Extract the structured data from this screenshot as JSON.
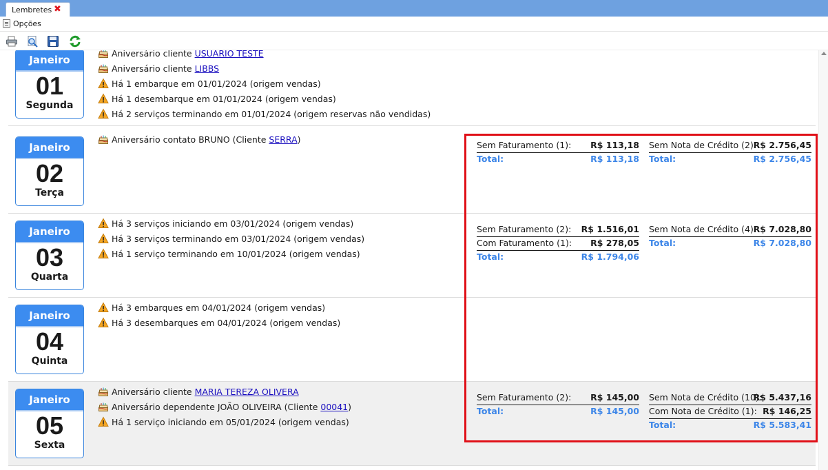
{
  "tab": {
    "title": "Lembretes"
  },
  "menu": {
    "options_label": "Opções"
  },
  "toolbar": {
    "buttons": [
      "print-icon",
      "preview-icon",
      "save-icon",
      "refresh-icon"
    ]
  },
  "colors": {
    "calendar_header": "#3c8cf0",
    "total_text": "#3d86e8",
    "highlight_border": "#e01018"
  },
  "days": [
    {
      "month": "Janeiro",
      "day": "01",
      "weekday": "Segunda",
      "events": [
        {
          "icon": "cake-icon",
          "text": "Aniversário cliente ",
          "link": "USUARIO TESTE",
          "suffix": ""
        },
        {
          "icon": "cake-icon",
          "text": "Aniversário cliente ",
          "link": "LIBBS",
          "suffix": ""
        },
        {
          "icon": "warning-icon",
          "text": "Há 1 embarque em 01/01/2024 (origem vendas)"
        },
        {
          "icon": "warning-icon",
          "text": "Há 1 desembarque em 01/01/2024 (origem vendas)"
        },
        {
          "icon": "warning-icon",
          "text": "Há 2 serviços terminando em 01/01/2024 (origem reservas não vendidas)"
        }
      ],
      "financial": null
    },
    {
      "month": "Janeiro",
      "day": "02",
      "weekday": "Terça",
      "events": [
        {
          "icon": "cake-icon",
          "text": "Aniversário contato BRUNO (Cliente ",
          "link": "SERRA",
          "suffix": ")"
        }
      ],
      "financial": {
        "col1": [
          {
            "label": "Sem Faturamento (1):",
            "value": "R$ 113,18"
          },
          {
            "label": "Total:",
            "value": "R$ 113,18",
            "total": true
          }
        ],
        "col2": [
          {
            "label": "Sem Nota de Crédito (2):",
            "value": "R$ 2.756,45"
          },
          {
            "label": "Total:",
            "value": "R$ 2.756,45",
            "total": true
          }
        ]
      }
    },
    {
      "month": "Janeiro",
      "day": "03",
      "weekday": "Quarta",
      "events": [
        {
          "icon": "warning-icon",
          "text": "Há 3 serviços iniciando em 03/01/2024 (origem vendas)"
        },
        {
          "icon": "warning-icon",
          "text": "Há 3 serviços terminando em 03/01/2024 (origem vendas)"
        },
        {
          "icon": "warning-icon",
          "text": "Há 1 serviço terminando em 10/01/2024 (origem vendas)"
        }
      ],
      "financial": {
        "col1": [
          {
            "label": "Sem Faturamento (2):",
            "value": "R$ 1.516,01"
          },
          {
            "label": "Com Faturamento (1):",
            "value": "R$ 278,05"
          },
          {
            "label": "Total:",
            "value": "R$ 1.794,06",
            "total": true
          }
        ],
        "col2": [
          {
            "label": "Sem Nota de Crédito (4):",
            "value": "R$ 7.028,80"
          },
          {
            "label": "Total:",
            "value": "R$ 7.028,80",
            "total": true
          }
        ]
      }
    },
    {
      "month": "Janeiro",
      "day": "04",
      "weekday": "Quinta",
      "events": [
        {
          "icon": "warning-icon",
          "text": "Há 3 embarques em 04/01/2024 (origem vendas)"
        },
        {
          "icon": "warning-icon",
          "text": "Há 3 desembarques em 04/01/2024 (origem vendas)"
        }
      ],
      "financial": null
    },
    {
      "month": "Janeiro",
      "day": "05",
      "weekday": "Sexta",
      "events": [
        {
          "icon": "cake-icon",
          "text": "Aniversário cliente ",
          "link": "MARIA TEREZA OLIVERA",
          "suffix": ""
        },
        {
          "icon": "cake-icon",
          "text": "Aniversário dependente JOÃO OLIVEIRA (Cliente ",
          "link": "00041",
          "suffix": ")"
        },
        {
          "icon": "warning-icon",
          "text": "Há 1 serviço iniciando em 05/01/2024 (origem vendas)"
        }
      ],
      "financial": {
        "col1": [
          {
            "label": "Sem Faturamento (2):",
            "value": "R$ 145,00"
          },
          {
            "label": "Total:",
            "value": "R$ 145,00",
            "total": true
          }
        ],
        "col2": [
          {
            "label": "Sem Nota de Crédito (10):",
            "value": "R$ 5.437,16"
          },
          {
            "label": "Com Nota de Crédito (1):",
            "value": "R$ 146,25"
          },
          {
            "label": "Total:",
            "value": "R$ 5.583,41",
            "total": true
          }
        ]
      }
    }
  ]
}
